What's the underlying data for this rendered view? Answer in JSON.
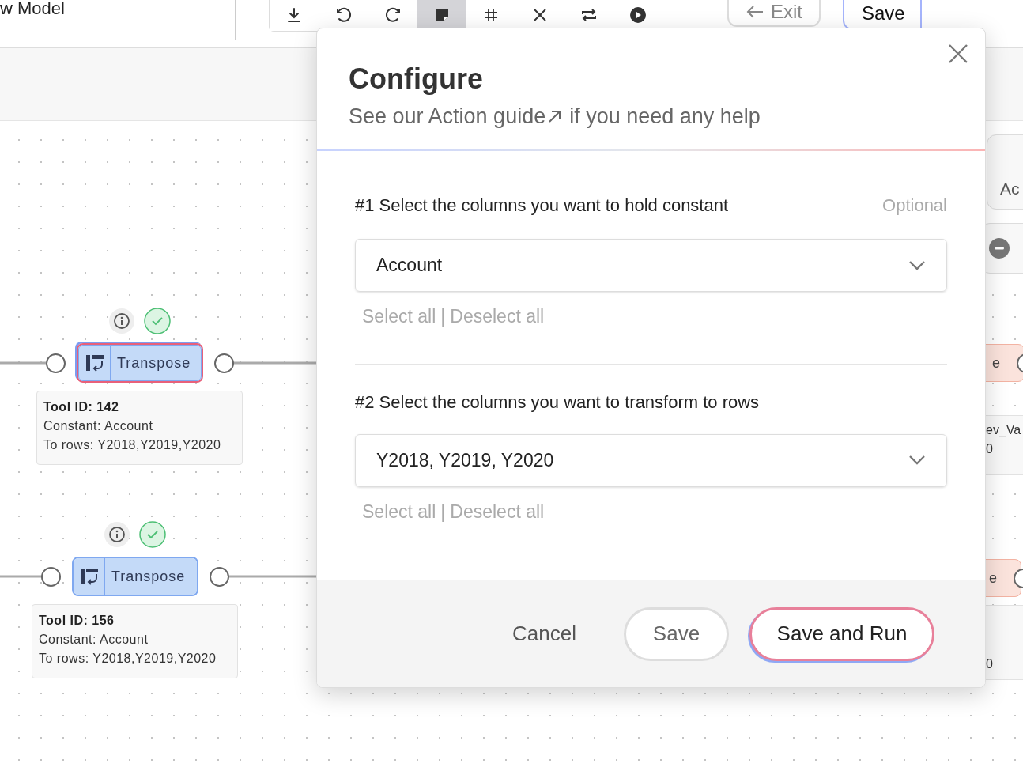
{
  "top_bar": {
    "title": "w Model",
    "toolbar": [
      {
        "kind": "download",
        "selected": false
      },
      {
        "kind": "undo",
        "selected": false
      },
      {
        "kind": "redo",
        "selected": false
      },
      {
        "kind": "note",
        "selected": true
      },
      {
        "kind": "grid",
        "selected": false
      },
      {
        "kind": "cross",
        "selected": false
      },
      {
        "kind": "swap",
        "selected": false
      },
      {
        "kind": "run",
        "selected": false
      }
    ],
    "exit": "Exit",
    "save": "Save"
  },
  "canvas": {
    "nodes": [
      {
        "label": "Transpose",
        "selected": true,
        "details": [
          "Tool ID: 142",
          "Constant: Account",
          "To rows: Y2018,Y2019,Y2020"
        ]
      },
      {
        "label": "Transpose",
        "selected": false,
        "details": [
          "Tool ID: 156",
          "Constant: Account",
          "To rows: Y2018,Y2019,Y2020"
        ]
      }
    ],
    "right_edge": {
      "card_text": "Ac",
      "node_labels": [
        "e",
        "e"
      ],
      "info_1": [
        "ev_Va",
        "0"
      ],
      "info_2": [
        "0"
      ]
    }
  },
  "dialog": {
    "title": "Configure",
    "link": "See our Action guide",
    "subtitle_after": "if you need any help",
    "sections": [
      {
        "label": "#1 Select the columns you want to hold constant",
        "note": "Optional",
        "value": "Account",
        "select_all": "Select all",
        "separator": "|",
        "deselect_all": "Deselect all"
      },
      {
        "label": "#2 Select the columns you want to transform to rows",
        "value": "Y2018, Y2019, Y2020",
        "select_all": "Select all",
        "separator": "|",
        "deselect_all": "Deselect all"
      }
    ],
    "buttons": [
      {
        "kind": "plain",
        "label": "Cancel"
      },
      {
        "kind": "outline",
        "label": "Save"
      },
      {
        "kind": "primary",
        "label": "Save and Run"
      }
    ]
  }
}
